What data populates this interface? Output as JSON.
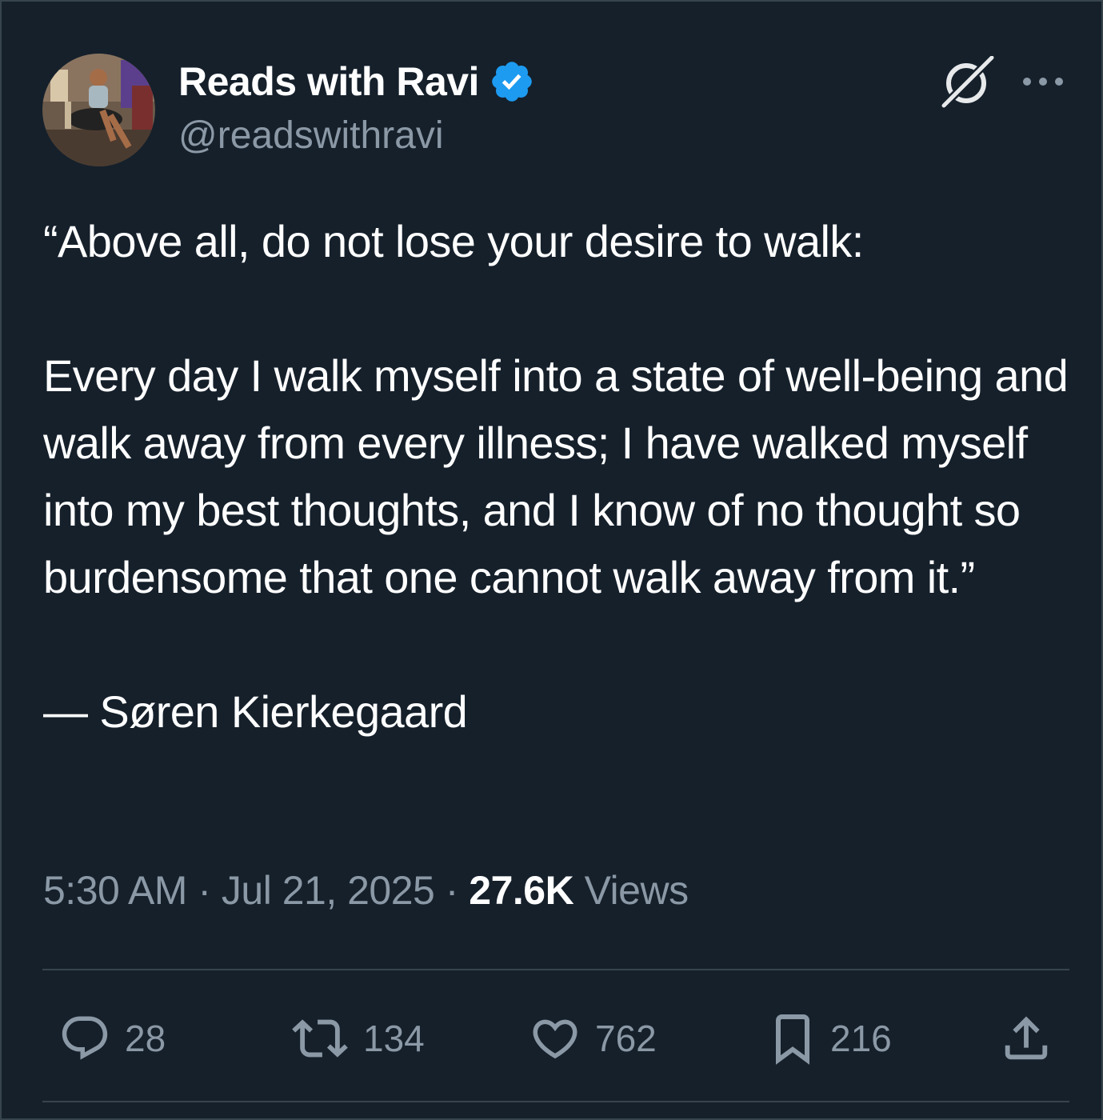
{
  "author": {
    "display_name": "Reads with Ravi",
    "handle": "@readswithravi",
    "verified": true,
    "verified_color": "#1d9bf0"
  },
  "tweet": {
    "paragraphs": [
      "“Above all, do not lose your desire to walk:",
      "Every day I walk myself into a state of well-being and walk away from every illness; I have walked myself into my best thoughts, and I know of no thought so burdensome that one cannot walk away from it.”",
      "— Søren Kierkegaard"
    ]
  },
  "meta": {
    "time": "5:30 AM",
    "separator1": " · ",
    "date": "Jul 21, 2025",
    "separator2": " · ",
    "views_count": "27.6K",
    "views_label": " Views"
  },
  "actions": {
    "reply": {
      "icon": "reply-icon",
      "count": "28"
    },
    "repost": {
      "icon": "repost-icon",
      "count": "134"
    },
    "like": {
      "icon": "heart-icon",
      "count": "762"
    },
    "bookmark": {
      "icon": "bookmark-icon",
      "count": "216"
    },
    "share": {
      "icon": "share-icon"
    }
  },
  "theme": {
    "background": "#15202b",
    "text_primary": "#ffffff",
    "text_secondary": "#8b98a5",
    "border": "#38444d"
  }
}
